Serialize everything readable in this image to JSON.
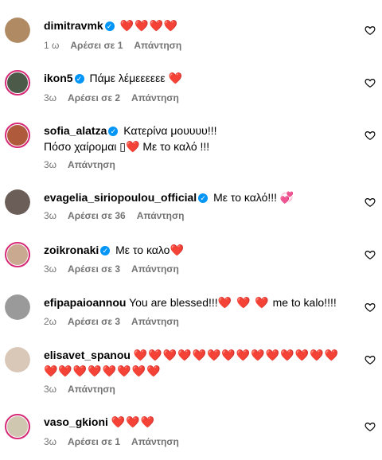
{
  "comments": [
    {
      "username": "dimitravmk",
      "text": "",
      "hearts": "❤️❤️❤️❤️",
      "line2": "",
      "time": "1 ω",
      "likes": "Αρέσει σε 1",
      "reply": "Απάντηση",
      "avatar_color": "#b08a62"
    },
    {
      "username": "ikon5",
      "text": "Πάμε λέμεεεεεε",
      "hearts": "❤️",
      "line2": "",
      "time": "3ω",
      "likes": "Αρέσει σε 2",
      "reply": "Απάντηση",
      "avatar_color": "#4c5a4a"
    },
    {
      "username": "sofia_alatza",
      "text": "Κατερίνα μουυυυ!!!",
      "hearts": "",
      "line2": "Πόσο χαίρομαι ▯❤️  Με το καλό !!!",
      "time": "3ω",
      "likes": "",
      "reply": "Απάντηση",
      "avatar_color": "#b05a3c"
    },
    {
      "username": "evagelia_siriopoulou_official",
      "text": "Με το καλό!!!",
      "hearts": "💞",
      "line2": "",
      "time": "3ω",
      "likes": "Αρέσει σε 36",
      "reply": "Απάντηση",
      "avatar_color": "#6b5e58"
    },
    {
      "username": "zoikronaki",
      "text": "Με το καλο",
      "hearts": "❤️",
      "line2": "",
      "time": "3ω",
      "likes": "Αρέσει σε 3",
      "reply": "Απάντηση",
      "avatar_color": "#c9a98f"
    },
    {
      "username": "efipapaioannou",
      "text": "You are blessed!!!",
      "hearts": "❤️ ❤️ ❤️",
      "tail": "me to kalo!!!!",
      "line2": "",
      "time": "2ω",
      "likes": "Αρέσει σε 3",
      "reply": "Απάντηση",
      "avatar_color": "#9a9a9a"
    },
    {
      "username": "elisavet_spanou",
      "text": "",
      "hearts": "❤️❤️❤️❤️❤️❤️❤️❤️❤️❤️❤️❤️❤️❤️",
      "line2": "❤️❤️❤️❤️❤️❤️❤️❤️",
      "time": "3ω",
      "likes": "",
      "reply": "Απάντηση",
      "avatar_color": "#d9c7b8"
    },
    {
      "username": "vaso_gkioni",
      "text": "",
      "hearts": "❤️❤️❤️",
      "line2": "",
      "time": "3ω",
      "likes": "Αρέσει σε 1",
      "reply": "Απάντηση",
      "avatar_color": "#cfc7b0"
    }
  ],
  "colors": {
    "accent_ring": "#d62976",
    "verified": "#0095f6",
    "meta_text": "#737373",
    "heart": "#ed1c24"
  }
}
